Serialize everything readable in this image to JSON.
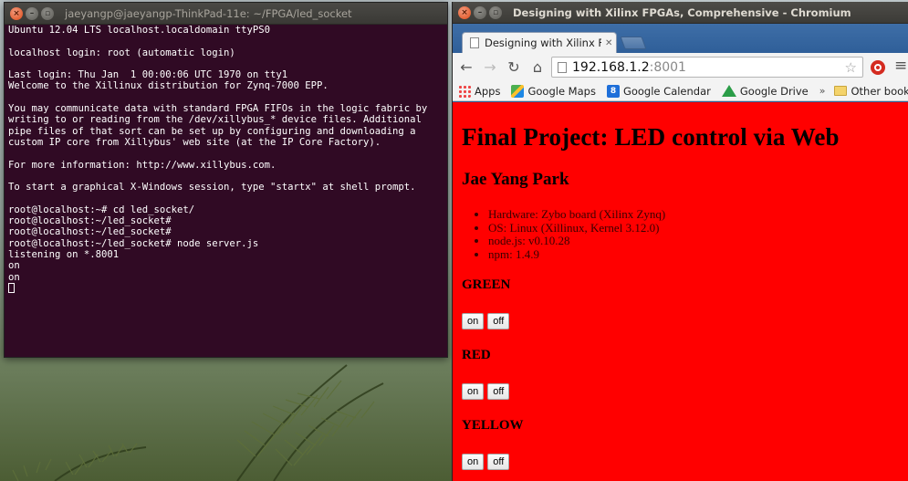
{
  "terminal": {
    "title": "jaeyangp@jaeyangp-ThinkPad-11e: ~/FPGA/led_socket",
    "lines": [
      "Ubuntu 12.04 LTS localhost.localdomain ttyPS0",
      "",
      "localhost login: root (automatic login)",
      "",
      "Last login: Thu Jan  1 00:00:06 UTC 1970 on tty1",
      "Welcome to the Xillinux distribution for Zynq-7000 EPP.",
      "",
      "You may communicate data with standard FPGA FIFOs in the logic fabric by",
      "writing to or reading from the /dev/xillybus_* device files. Additional",
      "pipe files of that sort can be set up by configuring and downloading a",
      "custom IP core from Xillybus' web site (at the IP Core Factory).",
      "",
      "For more information: http://www.xillybus.com.",
      "",
      "To start a graphical X-Windows session, type \"startx\" at shell prompt.",
      "",
      "root@localhost:~# cd led_socket/",
      "root@localhost:~/led_socket#",
      "root@localhost:~/led_socket#",
      "root@localhost:~/led_socket# node server.js",
      "listening on *.8001",
      "on",
      "on"
    ]
  },
  "browser": {
    "window_title": "Designing with Xilinx FPGAs, Comprehensive - Chromium",
    "tab_title": "Designing with Xilinx FPG",
    "url_host": "192.168.1.2",
    "url_port": ":8001",
    "bookmarks": {
      "apps": "Apps",
      "maps": "Google Maps",
      "calendar": "Google Calendar",
      "drive": "Google Drive",
      "chevron": "»",
      "other": "Other bookmarks"
    }
  },
  "page": {
    "title": "Final Project: LED control via Web",
    "author": "Jae Yang Park",
    "info": [
      "Hardware: Zybo board (Xilinx Zynq)",
      "OS: Linux (Xillinux, Kernel 3.12.0)",
      "node.js: v0.10.28",
      "npm: 1.4.9"
    ],
    "leds": [
      {
        "name": "GREEN",
        "on_label": "on",
        "off_label": "off"
      },
      {
        "name": "RED",
        "on_label": "on",
        "off_label": "off"
      },
      {
        "name": "YELLOW",
        "on_label": "on",
        "off_label": "off"
      }
    ],
    "background_color": "#ff0000"
  },
  "colors": {
    "terminal_bg": "#300a24",
    "titlebar": "#3c3b37",
    "close_button": "#df4a16",
    "chromium_frame": "#2f5f99"
  }
}
